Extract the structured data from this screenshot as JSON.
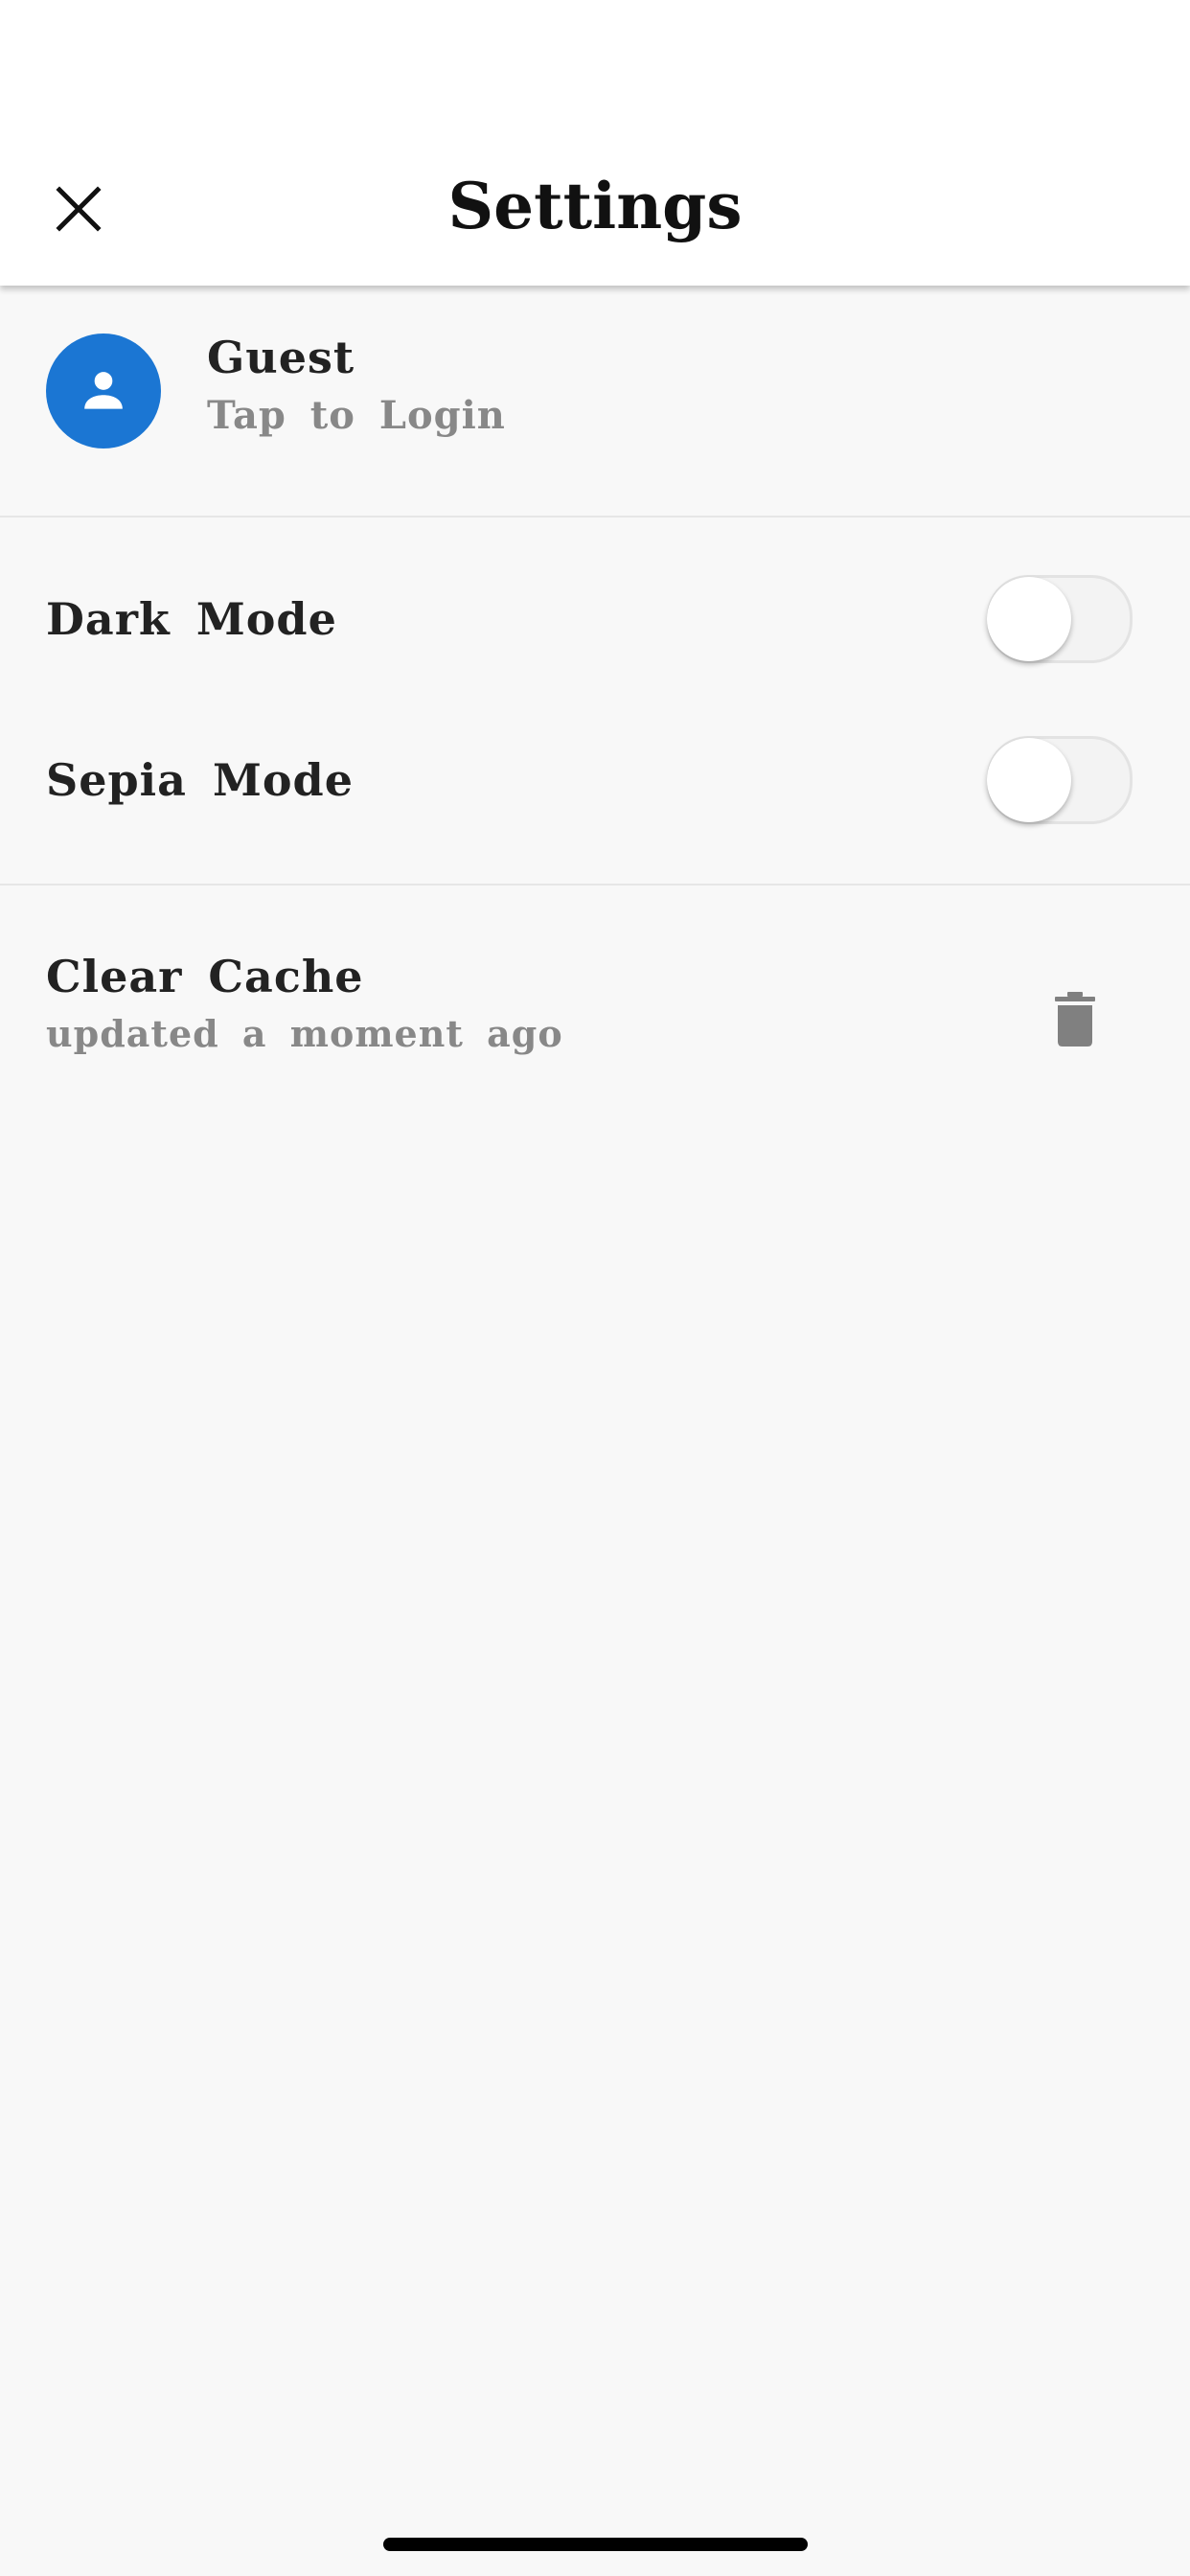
{
  "header": {
    "title": "Settings",
    "close_icon": "close-icon"
  },
  "profile": {
    "name": "Guest",
    "subtitle": "Tap to Login",
    "avatar_icon": "person-icon",
    "avatar_color": "#1b76d3"
  },
  "toggles": [
    {
      "label": "Dark Mode",
      "on": false
    },
    {
      "label": "Sepia Mode",
      "on": false
    }
  ],
  "cache": {
    "title": "Clear Cache",
    "subtitle": "updated a moment ago",
    "action_icon": "trash-icon"
  },
  "colors": {
    "accent": "#1b76d3",
    "background": "#f8f8f8",
    "header_background": "#ffffff",
    "primary_text": "#222222",
    "secondary_text": "#888888"
  }
}
